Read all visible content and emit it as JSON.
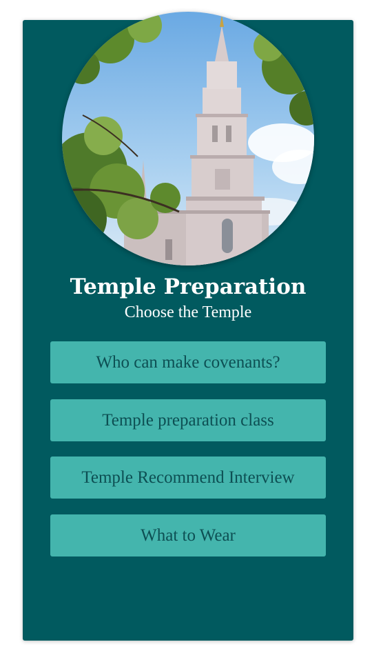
{
  "header": {
    "title": "Temple Preparation",
    "subtitle": "Choose the Temple"
  },
  "hero_image": {
    "description_icon": "temple-photo"
  },
  "menu": {
    "items": [
      {
        "label": "Who can make covenants?"
      },
      {
        "label": "Temple preparation class"
      },
      {
        "label": "Temple Recommend Interview"
      },
      {
        "label": "What to Wear"
      }
    ]
  },
  "colors": {
    "card_background": "#015a5f",
    "button_background": "#44b5ad",
    "button_text": "#0d4f53",
    "title_text": "#ffffff"
  }
}
